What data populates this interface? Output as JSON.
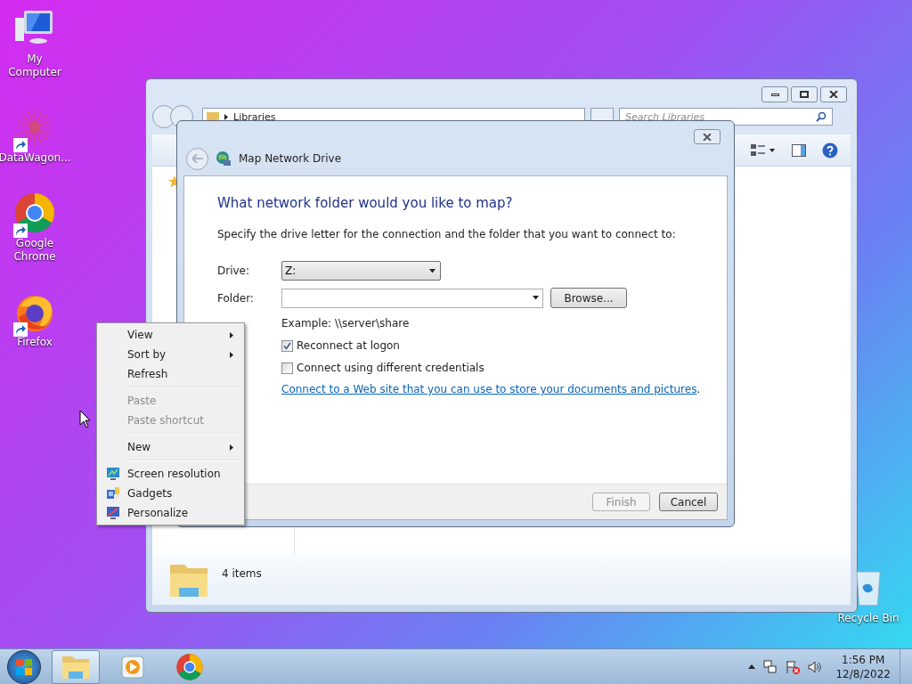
{
  "desktop_icons": [
    {
      "label": "My Computer",
      "kind": "computer",
      "shortcut": false
    },
    {
      "label": "DataWagon...",
      "kind": "burst",
      "shortcut": true
    },
    {
      "label": "Google\nChrome",
      "kind": "chrome",
      "shortcut": true
    },
    {
      "label": "Firefox",
      "kind": "firefox",
      "shortcut": true
    }
  ],
  "recycle_bin": {
    "label": "Recycle Bin"
  },
  "explorer": {
    "address": "Libraries",
    "search_placeholder": "Search Libraries",
    "status": "4 items"
  },
  "dialog": {
    "title": "Map Network Drive",
    "heading": "What network folder would you like to map?",
    "instruction": "Specify the drive letter for the connection and the folder that you want to connect to:",
    "fields": [
      {
        "label": "Drive:",
        "kind": "dropdown",
        "value": "Z:"
      },
      {
        "label": "Folder:",
        "kind": "combo"
      }
    ],
    "browse_button": "Browse...",
    "example": "Example: \\\\server\\share",
    "checkboxes": [
      {
        "label": "Reconnect at logon",
        "checked": true
      },
      {
        "label": "Connect using different credentials",
        "checked": false
      }
    ],
    "link": "Connect to a Web site that you can use to store your documents and pictures",
    "link_suffix": ".",
    "buttons": [
      {
        "label": "Finish",
        "disabled": true
      },
      {
        "label": "Cancel",
        "disabled": false
      }
    ]
  },
  "context_menu": {
    "items": [
      {
        "label": "View",
        "kind": "submenu",
        "disabled": false
      },
      {
        "label": "Sort by",
        "kind": "submenu",
        "disabled": false
      },
      {
        "label": "Refresh",
        "kind": "plain",
        "disabled": false
      },
      {
        "kind": "separator"
      },
      {
        "label": "Paste",
        "kind": "plain",
        "disabled": true
      },
      {
        "label": "Paste shortcut",
        "kind": "plain",
        "disabled": true
      },
      {
        "kind": "separator"
      },
      {
        "label": "New",
        "kind": "submenu",
        "disabled": false
      },
      {
        "kind": "separator"
      },
      {
        "label": "Screen resolution",
        "kind": "icon",
        "disabled": false
      },
      {
        "label": "Gadgets",
        "kind": "icon",
        "disabled": false
      },
      {
        "label": "Personalize",
        "kind": "icon",
        "disabled": false
      }
    ]
  },
  "taskbar": {
    "apps": [
      {
        "kind": "explorer",
        "selected": true
      },
      {
        "kind": "media",
        "selected": false
      },
      {
        "kind": "chrome",
        "selected": false
      }
    ],
    "time": "1:56 PM",
    "date": "12/8/2022"
  }
}
